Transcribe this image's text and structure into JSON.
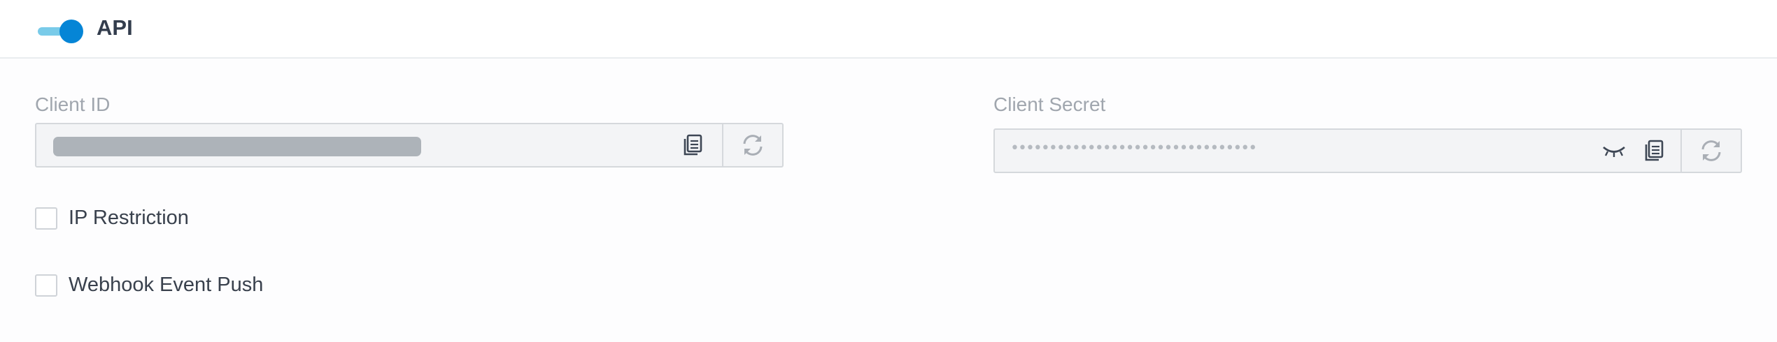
{
  "header": {
    "title": "API",
    "toggle_enabled": true,
    "toggle_color": "#0585d6"
  },
  "client_id": {
    "label": "Client ID",
    "value_masked": true,
    "copy_icon": "copy-icon",
    "regenerate_icon": "refresh-icon"
  },
  "client_secret": {
    "label": "Client Secret",
    "value": "••••••••••••••••••••••••••••••••",
    "visibility_icon": "eye-closed-icon",
    "copy_icon": "copy-icon",
    "regenerate_icon": "refresh-icon"
  },
  "options": [
    {
      "label": "IP Restriction",
      "checked": false
    },
    {
      "label": "Webhook Event Push",
      "checked": false
    }
  ]
}
